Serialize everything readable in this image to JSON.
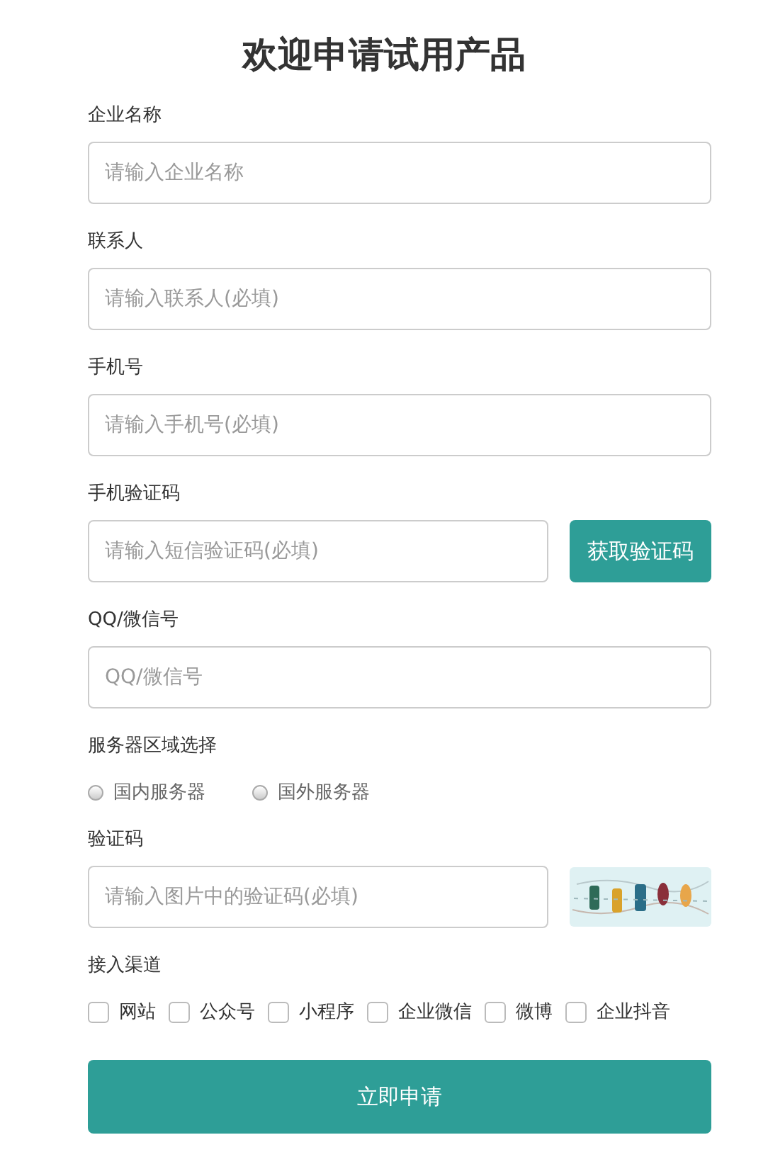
{
  "title": "欢迎申请试用产品",
  "sections": [
    {
      "kind": "input",
      "label": "企业名称",
      "placeholder": "请输入企业名称"
    },
    {
      "kind": "input",
      "label": "联系人",
      "placeholder": "请输入联系人(必填)"
    },
    {
      "kind": "input",
      "label": "手机号",
      "placeholder": "请输入手机号(必填)"
    },
    {
      "kind": "sms",
      "label": "手机验证码",
      "placeholder": "请输入短信验证码(必填)",
      "button": "获取验证码"
    },
    {
      "kind": "input",
      "label": "QQ/微信号",
      "placeholder": "QQ/微信号"
    },
    {
      "kind": "radio",
      "label": "服务器区域选择",
      "options": [
        {
          "label": "国内服务器",
          "selected": false
        },
        {
          "label": "国外服务器",
          "selected": false
        }
      ]
    },
    {
      "kind": "captcha",
      "label": "验证码",
      "placeholder": "请输入图片中的验证码(必填)"
    },
    {
      "kind": "checks",
      "label": "接入渠道",
      "options": [
        {
          "label": "网站",
          "checked": false
        },
        {
          "label": "公众号",
          "checked": false
        },
        {
          "label": "小程序",
          "checked": false
        },
        {
          "label": "企业微信",
          "checked": false
        },
        {
          "label": "微博",
          "checked": false
        },
        {
          "label": "企业抖音",
          "checked": false
        }
      ]
    }
  ],
  "submit": "立即申请"
}
